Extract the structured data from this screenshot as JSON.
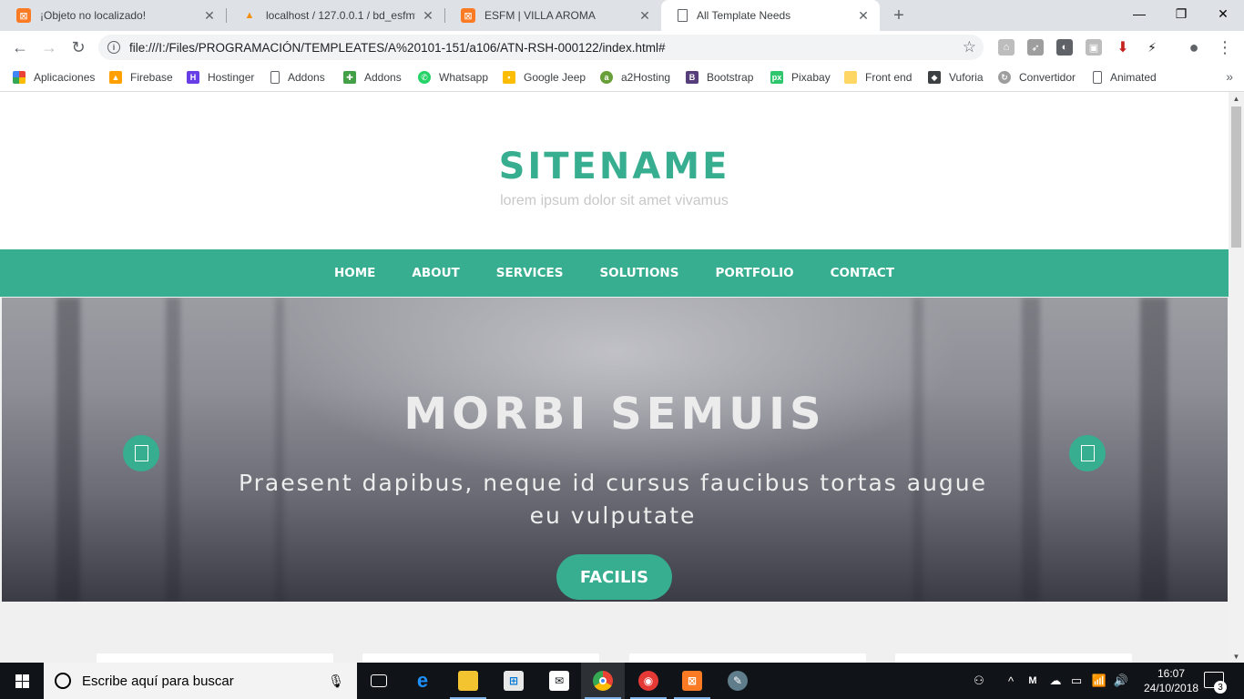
{
  "browser": {
    "tabs": [
      {
        "title": "¡Objeto no localizado!",
        "favicon": "xampp-icon",
        "close": "✕"
      },
      {
        "title": "localhost / 127.0.0.1 / bd_esfmva",
        "favicon": "phpmyadmin-icon",
        "close": "✕"
      },
      {
        "title": "ESFM | VILLA AROMA",
        "favicon": "xampp-icon",
        "close": "✕"
      },
      {
        "title": "All Template Needs",
        "favicon": "page-icon",
        "close": "✕"
      }
    ],
    "active_tab_index": 3,
    "new_tab_label": "+",
    "window_controls": {
      "minimize": "—",
      "restore": "❐",
      "close": "✕"
    },
    "nav": {
      "back": "←",
      "forward": "→",
      "reload": "↻"
    },
    "url": "file:///I:/Files/PROGRAMACIÓN/TEMPLEATES/A%20101-151/a106/ATN-RSH-000122/index.html#",
    "info_glyph": "i",
    "star_glyph": "☆",
    "profile_glyph": "●",
    "menu_glyph": "⋮",
    "bookmarks": [
      {
        "label": "Aplicaciones",
        "icon": "apps-grid-icon"
      },
      {
        "label": "Firebase",
        "icon": "firebase-icon"
      },
      {
        "label": "Hostinger",
        "icon": "hostinger-icon"
      },
      {
        "label": "Addons",
        "icon": "page-icon"
      },
      {
        "label": "Addons",
        "icon": "puzzle-icon"
      },
      {
        "label": "Whatsapp",
        "icon": "whatsapp-icon"
      },
      {
        "label": "Google Jeep",
        "icon": "keep-icon"
      },
      {
        "label": "a2Hosting",
        "icon": "a2hosting-icon"
      },
      {
        "label": "Bootstrap",
        "icon": "bootstrap-icon"
      },
      {
        "label": "Pixabay",
        "icon": "pixabay-icon"
      },
      {
        "label": "Front end",
        "icon": "folder-icon"
      },
      {
        "label": "Vuforia",
        "icon": "vuforia-icon"
      },
      {
        "label": "Convertidor",
        "icon": "convert-icon"
      },
      {
        "label": "Animated",
        "icon": "page-icon"
      }
    ],
    "bookmarks_more": "»"
  },
  "site": {
    "name": "SITENAME",
    "tagline": "lorem ipsum dolor sit amet vivamus",
    "nav": [
      "HOME",
      "ABOUT",
      "SERVICES",
      "SOLUTIONS",
      "PORTFOLIO",
      "CONTACT"
    ],
    "hero": {
      "title": "MORBI SEMUIS",
      "subtitle": "Praesent dapibus, neque id cursus faucibus tortas augue eu vulputate",
      "button": "FACILIS"
    },
    "accent_color": "#37ae8f"
  },
  "taskbar": {
    "search_placeholder": "Escribe aquí para buscar",
    "time": "16:07",
    "date": "24/10/2018",
    "notification_count": "3"
  }
}
